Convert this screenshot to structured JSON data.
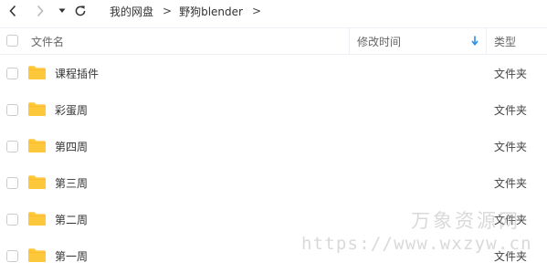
{
  "toolbar": {
    "back_icon": "chevron-left-icon",
    "forward_icon": "chevron-right-icon",
    "history_icon": "caret-down-icon",
    "refresh_icon": "refresh-icon"
  },
  "breadcrumb": {
    "items": [
      "我的网盘",
      "野狗blender"
    ],
    "separator": ">"
  },
  "columns": {
    "name": "文件名",
    "modified": "修改时间",
    "type": "类型",
    "sort_icon": "arrow-down-icon",
    "sort_color": "#2b8ee8"
  },
  "rows": [
    {
      "name": "课程插件",
      "type": "文件夹"
    },
    {
      "name": "彩蛋周",
      "type": "文件夹"
    },
    {
      "name": "第四周",
      "type": "文件夹"
    },
    {
      "name": "第三周",
      "type": "文件夹"
    },
    {
      "name": "第二周",
      "type": "文件夹"
    },
    {
      "name": "第一周",
      "type": "文件夹"
    }
  ],
  "folder_color": "#ffc73a",
  "watermark": {
    "title": "万象资源网",
    "url": "https://www.wxzyw.cn"
  }
}
